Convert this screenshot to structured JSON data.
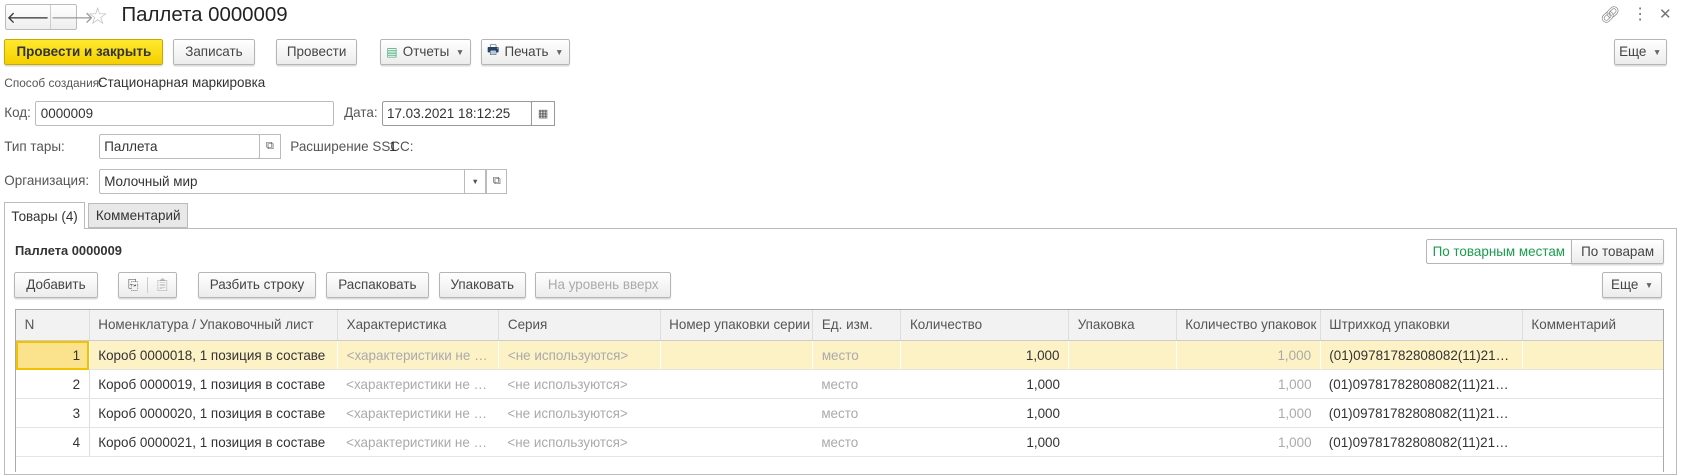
{
  "header": {
    "title": "Паллета 0000009"
  },
  "toolbar": {
    "post_close": "Провести и закрыть",
    "save": "Записать",
    "post": "Провести",
    "reports": "Отчеты",
    "print": "Печать",
    "more": "Еще"
  },
  "form": {
    "creation_label": "Способ создания:",
    "creation_value": "Стационарная маркировка",
    "code_label": "Код:",
    "code_value": "0000009",
    "date_label": "Дата:",
    "date_value": "17.03.2021 18:12:25",
    "tare_label": "Тип тары:",
    "tare_value": "Паллета",
    "sscc_label": "Расширение SSCC:",
    "sscc_value": "1",
    "org_label": "Организация:",
    "org_value": "Молочный мир"
  },
  "tabs": [
    {
      "label": "Товары (4)"
    },
    {
      "label": "Комментарий"
    }
  ],
  "panel": {
    "title": "Паллета 0000009",
    "toggle": [
      "По товарным местам",
      "По товарам"
    ],
    "add": "Добавить",
    "split": "Разбить строку",
    "unpack": "Распаковать",
    "pack": "Упаковать",
    "level_up": "На уровень вверх",
    "more": "Еще"
  },
  "table": {
    "columns": [
      "N",
      "Номенклатура / Упаковочный лист",
      "Характеристика",
      "Серия",
      "Номер упаковки серии",
      "Ед. изм.",
      "Количество",
      "Упаковка",
      "Количество упаковок",
      "Штрихкод упаковки",
      "Комментарий"
    ],
    "rows": [
      [
        "1",
        "Короб 0000018, 1 позиция в составе",
        "<характеристики не и...",
        "<не используются>",
        "",
        "место",
        "1,000",
        "",
        "1,000",
        "(01)09781782808082(11)2103...",
        ""
      ],
      [
        "2",
        "Короб 0000019, 1 позиция в составе",
        "<характеристики не и...",
        "<не используются>",
        "",
        "место",
        "1,000",
        "",
        "1,000",
        "(01)09781782808082(11)2103...",
        ""
      ],
      [
        "3",
        "Короб 0000020, 1 позиция в составе",
        "<характеристики не и...",
        "<не используются>",
        "",
        "место",
        "1,000",
        "",
        "1,000",
        "(01)09781782808082(11)2103...",
        ""
      ],
      [
        "4",
        "Короб 0000021, 1 позиция в составе",
        "<характеристики не и...",
        "<не используются>",
        "",
        "место",
        "1,000",
        "",
        "1,000",
        "(01)09781782808082(11)2103...",
        ""
      ]
    ]
  },
  "colors": {
    "accent": "#f5cf00",
    "selected_row": "#fdf1c6",
    "toggle_active": "#1a9e4b"
  }
}
